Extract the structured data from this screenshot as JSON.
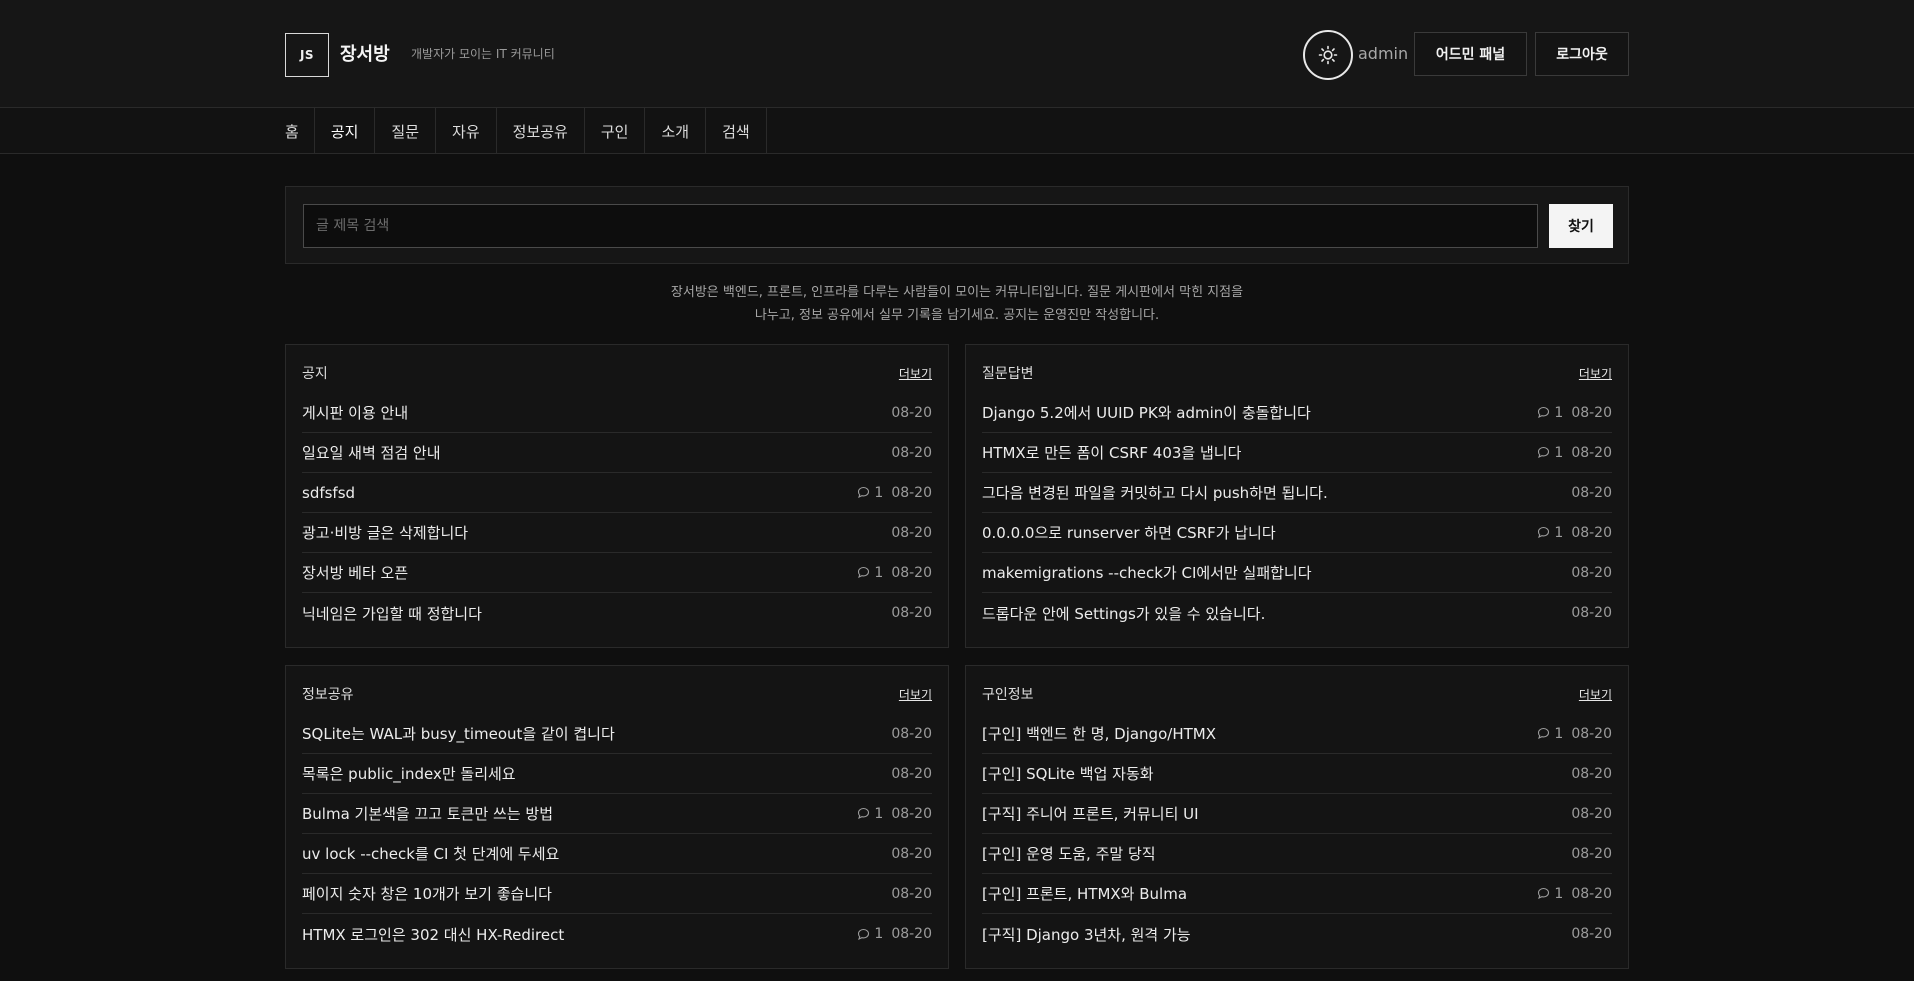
{
  "header": {
    "logo": "JS",
    "site_name": "장서방",
    "tagline": "개발자가 모이는 IT 커뮤니티",
    "theme_icon": "sun-icon",
    "username": "admin",
    "admin_button": "어드민 패널",
    "logout_button": "로그아웃"
  },
  "nav": {
    "items": [
      "홈",
      "공지",
      "질문",
      "자유",
      "정보공유",
      "구인",
      "소개",
      "검색"
    ]
  },
  "search": {
    "placeholder": "글 제목 검색",
    "value": "",
    "button": "찾기"
  },
  "intro": {
    "line1": "장서방은 백엔드, 프론트, 인프라를 다루는 사람들이 모이는 커뮤니티입니다. 질문 게시판에서 막힌 지점을",
    "line2": "나누고, 정보 공유에서 실무 기록을 남기세요. 공지는 운영진만 작성합니다."
  },
  "boards": [
    {
      "title": "공지",
      "more": "더보기",
      "posts": [
        {
          "title": "게시판 이용 안내",
          "comments": "",
          "date": "08-20"
        },
        {
          "title": "일요일 새벽 점검 안내",
          "comments": "",
          "date": "08-20"
        },
        {
          "title": "sdfsfsd",
          "comments": "1",
          "date": "08-20"
        },
        {
          "title": "광고·비방 글은 삭제합니다",
          "comments": "",
          "date": "08-20"
        },
        {
          "title": "장서방 베타 오픈",
          "comments": "1",
          "date": "08-20"
        },
        {
          "title": "닉네임은 가입할 때 정합니다",
          "comments": "",
          "date": "08-20"
        }
      ]
    },
    {
      "title": "질문답변",
      "more": "더보기",
      "posts": [
        {
          "title": "Django 5.2에서 UUID PK와 admin이 충돌합니다",
          "comments": "1",
          "date": "08-20"
        },
        {
          "title": "HTMX로 만든 폼이 CSRF 403을 냅니다",
          "comments": "1",
          "date": "08-20"
        },
        {
          "title": "그다음 변경된 파일을 커밋하고 다시 push하면 됩니다.",
          "comments": "",
          "date": "08-20"
        },
        {
          "title": "0.0.0.0으로 runserver 하면 CSRF가 납니다",
          "comments": "1",
          "date": "08-20"
        },
        {
          "title": "makemigrations --check가 CI에서만 실패합니다",
          "comments": "",
          "date": "08-20"
        },
        {
          "title": "드롭다운 안에 Settings가 있을 수 있습니다.",
          "comments": "",
          "date": "08-20"
        }
      ]
    },
    {
      "title": "정보공유",
      "more": "더보기",
      "posts": [
        {
          "title": "SQLite는 WAL과 busy_timeout을 같이 켭니다",
          "comments": "",
          "date": "08-20"
        },
        {
          "title": "목록은 public_index만 돌리세요",
          "comments": "",
          "date": "08-20"
        },
        {
          "title": "Bulma 기본색을 끄고 토큰만 쓰는 방법",
          "comments": "1",
          "date": "08-20"
        },
        {
          "title": "uv lock --check를 CI 첫 단계에 두세요",
          "comments": "",
          "date": "08-20"
        },
        {
          "title": "페이지 숫자 창은 10개가 보기 좋습니다",
          "comments": "",
          "date": "08-20"
        },
        {
          "title": "HTMX 로그인은 302 대신 HX-Redirect",
          "comments": "1",
          "date": "08-20"
        }
      ]
    },
    {
      "title": "구인정보",
      "more": "더보기",
      "posts": [
        {
          "title": "[구인] 백엔드 한 명, Django/HTMX",
          "comments": "1",
          "date": "08-20"
        },
        {
          "title": "[구인] SQLite 백업 자동화",
          "comments": "",
          "date": "08-20"
        },
        {
          "title": "[구직] 주니어 프론트, 커뮤니티 UI",
          "comments": "",
          "date": "08-20"
        },
        {
          "title": "[구인] 운영 도움, 주말 당직",
          "comments": "",
          "date": "08-20"
        },
        {
          "title": "[구인] 프론트, HTMX와 Bulma",
          "comments": "1",
          "date": "08-20"
        },
        {
          "title": "[구직] Django 3년차, 원격 가능",
          "comments": "",
          "date": "08-20"
        }
      ]
    }
  ],
  "icons": {
    "comment": "comment-bubble-icon"
  }
}
